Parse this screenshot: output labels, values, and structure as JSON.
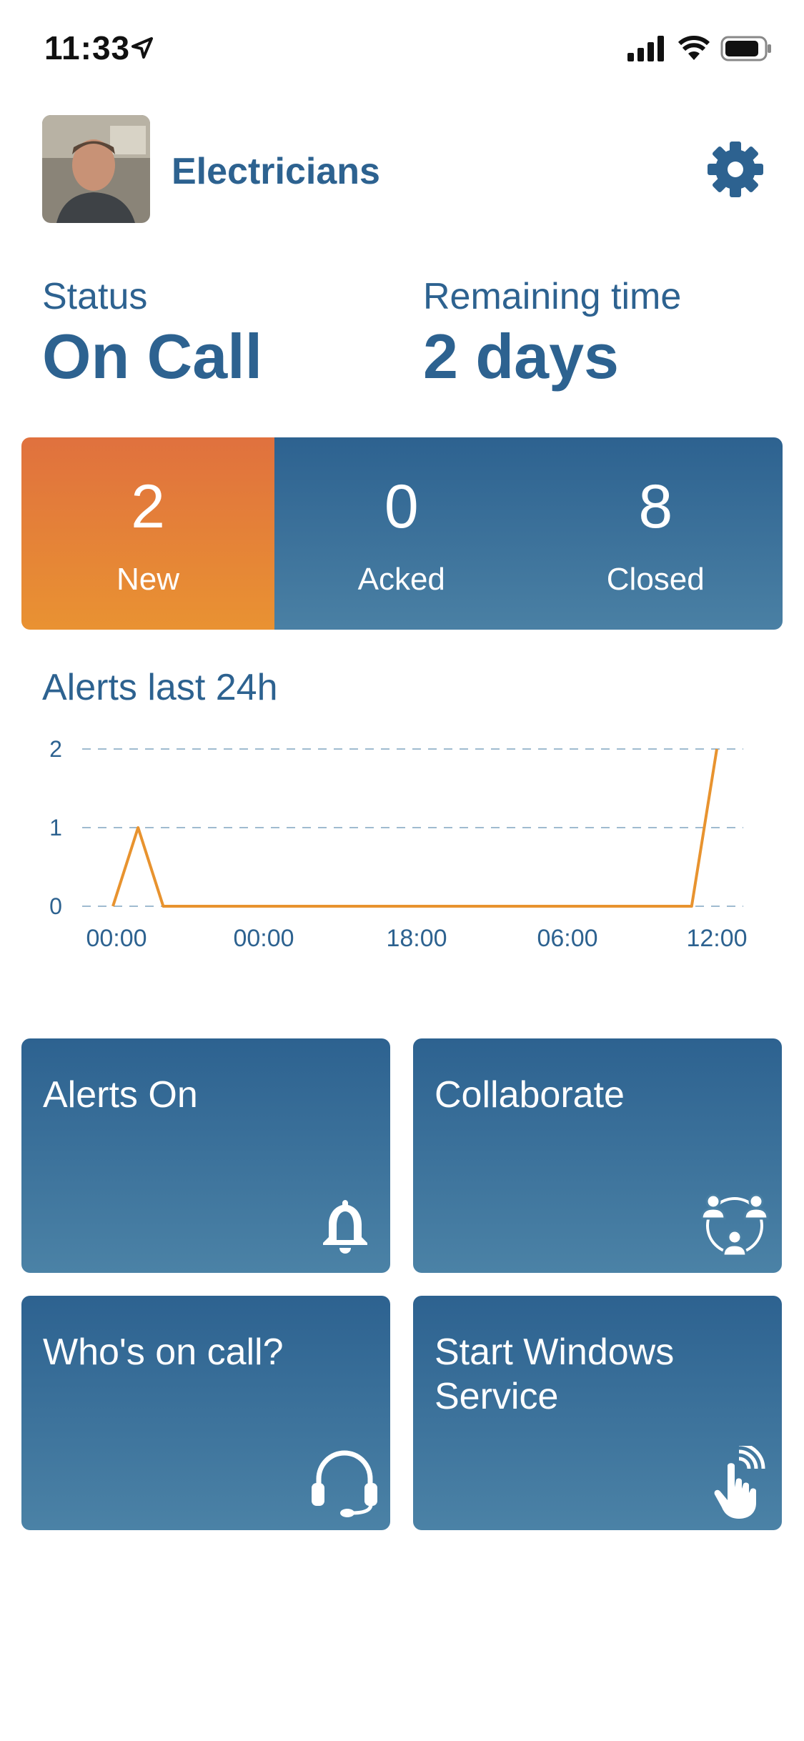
{
  "status_bar": {
    "time": "11:33"
  },
  "header": {
    "group_name": "Electricians"
  },
  "status": {
    "label": "Status",
    "value": "On Call"
  },
  "remaining": {
    "label": "Remaining time",
    "value": "2 days"
  },
  "counts": [
    {
      "value": "2",
      "label": "New"
    },
    {
      "value": "0",
      "label": "Acked"
    },
    {
      "value": "8",
      "label": "Closed"
    }
  ],
  "chart_title": "Alerts last 24h",
  "chart_data": {
    "type": "line",
    "title": "Alerts last 24h",
    "xlabel": "",
    "ylabel": "",
    "x_tick_labels": [
      "00:00",
      "00:00",
      "18:00",
      "06:00",
      "12:00"
    ],
    "y_ticks": [
      0,
      1,
      2
    ],
    "ylim": [
      0,
      2
    ],
    "grid": "horizontal dashed",
    "series": [
      {
        "color": "#e8932f",
        "x": [
          0,
          1,
          2,
          3,
          4,
          5,
          6,
          7,
          8,
          9,
          10,
          11,
          12,
          13,
          14,
          15,
          16,
          17,
          18,
          19,
          20,
          21,
          22,
          23,
          24
        ],
        "values": [
          0,
          1,
          0,
          0,
          0,
          0,
          0,
          0,
          0,
          0,
          0,
          0,
          0,
          0,
          0,
          0,
          0,
          0,
          0,
          0,
          0,
          0,
          0,
          0,
          2
        ]
      }
    ]
  },
  "tiles": [
    {
      "label": "Alerts On",
      "icon": "bell-icon"
    },
    {
      "label": "Collaborate",
      "icon": "collaborate-icon"
    },
    {
      "label": "Who's on call?",
      "icon": "headset-icon"
    },
    {
      "label": "Start Windows Service",
      "icon": "tap-hand-icon"
    }
  ],
  "colors": {
    "primary": "#2d6290",
    "accent": "#e8932f",
    "new_tile": "#e0713e"
  }
}
